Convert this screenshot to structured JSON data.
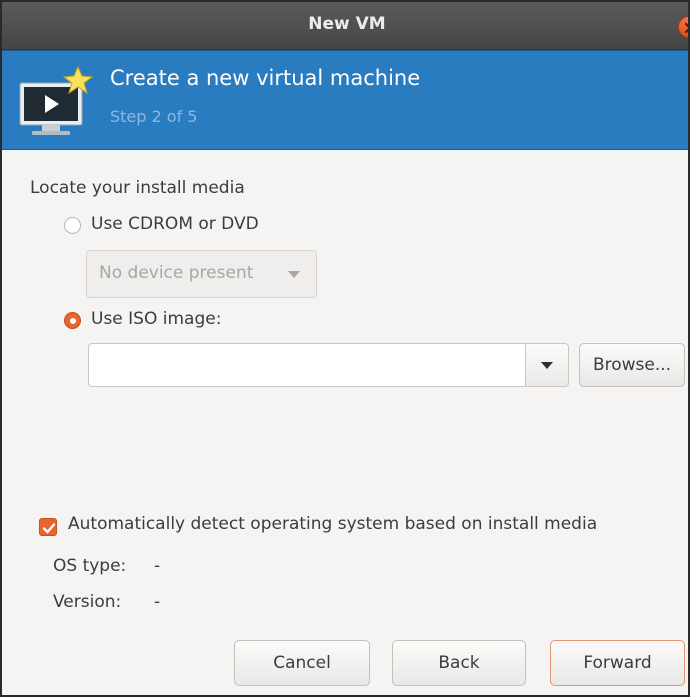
{
  "window": {
    "title": "New VM"
  },
  "banner": {
    "title": "Create a new virtual machine",
    "step": "Step 2 of 5"
  },
  "media": {
    "heading": "Locate your install media",
    "cdrom_label": "Use CDROM or DVD",
    "cdrom_selected": false,
    "device_select": "No device present",
    "iso_label": "Use ISO image:",
    "iso_selected": true,
    "iso_path": "",
    "browse_label": "Browse..."
  },
  "detect": {
    "checkbox_label": "Automatically detect operating system based on install media",
    "checked": true,
    "os_type_label": "OS type:",
    "os_type_value": "-",
    "version_label": "Version:",
    "version_value": "-"
  },
  "footer": {
    "cancel": "Cancel",
    "back": "Back",
    "forward": "Forward"
  },
  "icons": {
    "close": "close-icon",
    "monitor": "monitor-icon",
    "star": "star-icon",
    "dropdown": "chevron-down-icon",
    "check": "check-icon"
  },
  "colors": {
    "accent": "#e8652b",
    "banner": "#2a7cc1",
    "titlebar": "#4f4f4f"
  }
}
